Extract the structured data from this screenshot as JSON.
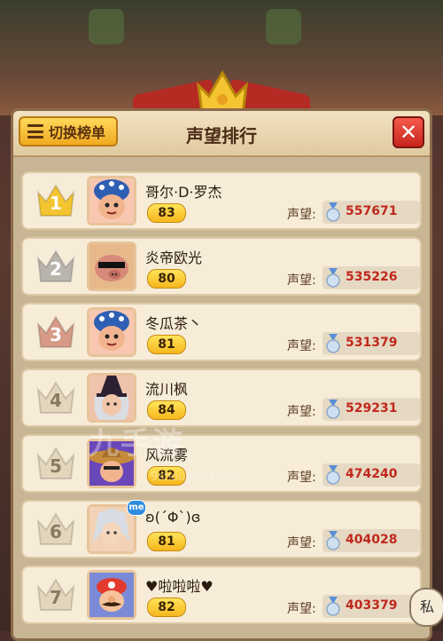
{
  "header": {
    "switch_label": "切换榜单",
    "title": "声望排行",
    "close_symbol": "✕"
  },
  "rep_label": "声望:",
  "watermark": {
    "main": "九手游",
    "sub": "9shouyou.Com"
  },
  "chat_button": "私",
  "rows": [
    {
      "rank": "1",
      "name": "哥尔·D·罗杰",
      "level": "83",
      "reputation": "557671",
      "crown": "gold",
      "avatar": "blue-hat"
    },
    {
      "rank": "2",
      "name": "炎帝欧光",
      "level": "80",
      "reputation": "535226",
      "crown": "silver",
      "avatar": "pig"
    },
    {
      "rank": "3",
      "name": "冬瓜茶丶",
      "level": "81",
      "reputation": "531379",
      "crown": "bronze",
      "avatar": "blue-hat"
    },
    {
      "rank": "4",
      "name": "流川枫",
      "level": "84",
      "reputation": "529231",
      "crown": "plain",
      "avatar": "witch"
    },
    {
      "rank": "5",
      "name": "风流雾",
      "level": "82",
      "reputation": "474240",
      "crown": "plain",
      "avatar": "straw-hat"
    },
    {
      "rank": "6",
      "name": "ʚ(´Φ`)ɞ",
      "level": "81",
      "reputation": "404028",
      "crown": "plain",
      "avatar": "silver-hair",
      "badge": "me"
    },
    {
      "rank": "7",
      "name": "♥啦啦啦♥",
      "level": "82",
      "reputation": "403379",
      "crown": "plain",
      "avatar": "mario"
    }
  ],
  "colors": {
    "gold": "#f4c530",
    "silver": "#b9b4ad",
    "bronze": "#d69a86",
    "plain": "#e4d6bc"
  }
}
